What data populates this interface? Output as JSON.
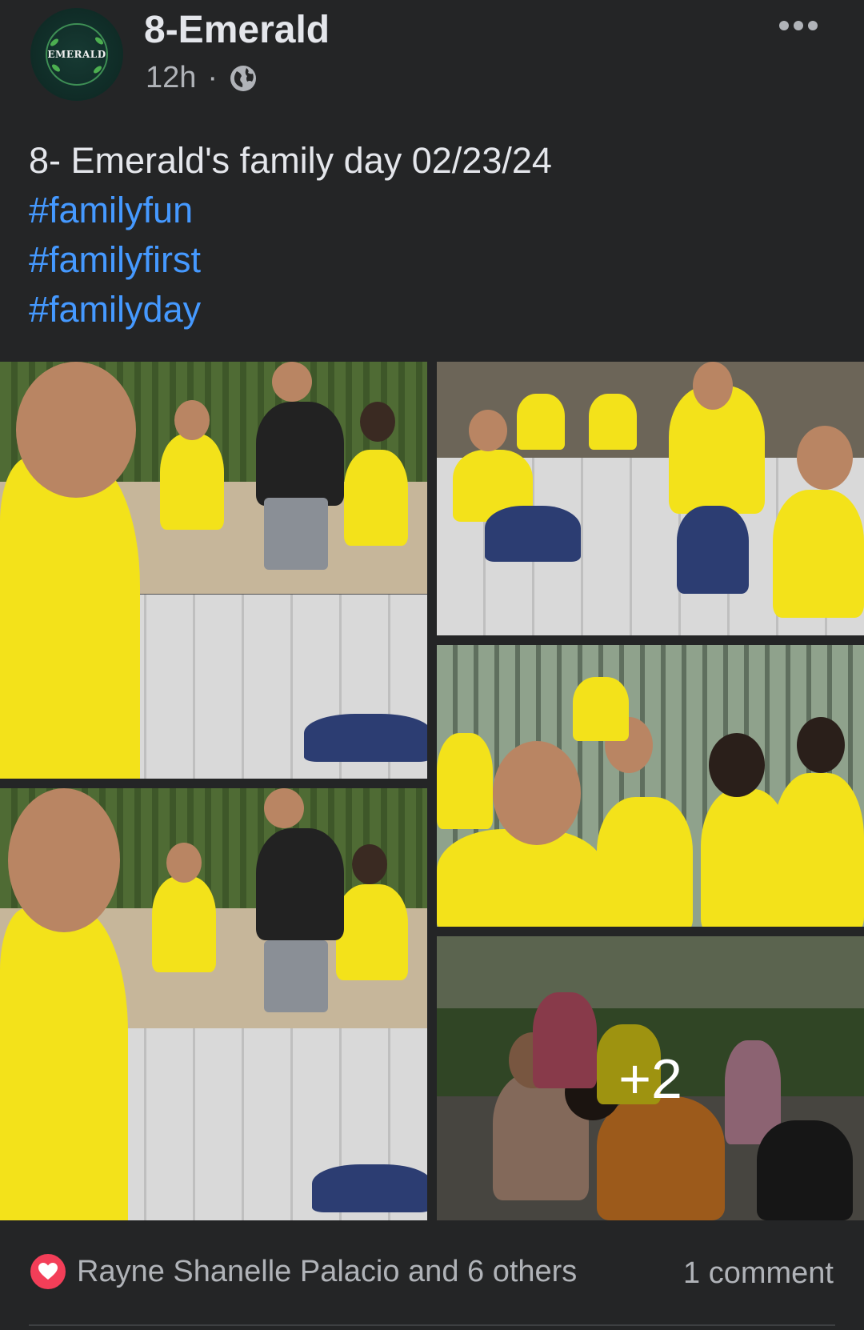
{
  "post": {
    "author": "8-Emerald",
    "avatar_text": "EMERALD",
    "time": "12h",
    "separator": "·",
    "privacy_icon": "globe-icon",
    "text": "8- Emerald's family day 02/23/24",
    "hashtags": [
      "#familyfun",
      "#familyfirst",
      "#familyday"
    ],
    "photo_more_count": "+2"
  },
  "footer": {
    "reactions_label": "Rayne Shanelle Palacio and 6 others",
    "reaction_icon": "heart-icon",
    "comments_label": "1 comment"
  },
  "colors": {
    "background": "#242526",
    "text": "#e4e6eb",
    "secondary_text": "#b0b3b8",
    "hashtag": "#4599ff",
    "heart": "#f33e58",
    "shirt_yellow": "#f3e21a"
  }
}
